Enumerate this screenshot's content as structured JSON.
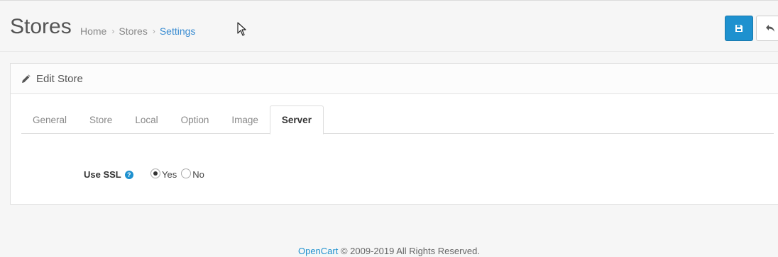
{
  "header": {
    "title": "Stores",
    "breadcrumb": [
      "Home",
      "Stores",
      "Settings"
    ],
    "breadcrumb_separator": "›"
  },
  "toolbar": {
    "save_icon": "floppy-disk-icon",
    "back_icon": "reply-arrow-icon"
  },
  "panel": {
    "heading_icon": "pencil-icon",
    "heading": "Edit Store",
    "tabs": [
      {
        "label": "General",
        "active": false
      },
      {
        "label": "Store",
        "active": false
      },
      {
        "label": "Local",
        "active": false
      },
      {
        "label": "Option",
        "active": false
      },
      {
        "label": "Image",
        "active": false
      },
      {
        "label": "Server",
        "active": true
      }
    ],
    "ssl": {
      "label": "Use SSL",
      "help_icon": "?",
      "options": [
        "Yes",
        "No"
      ],
      "selected": "Yes"
    }
  },
  "footer": {
    "brand": "OpenCart",
    "copyright": "© 2009-2019 All Rights Reserved."
  },
  "colors": {
    "primary": "#1e91cf",
    "link": "#3a8cd1",
    "background": "#f6f6f6"
  }
}
